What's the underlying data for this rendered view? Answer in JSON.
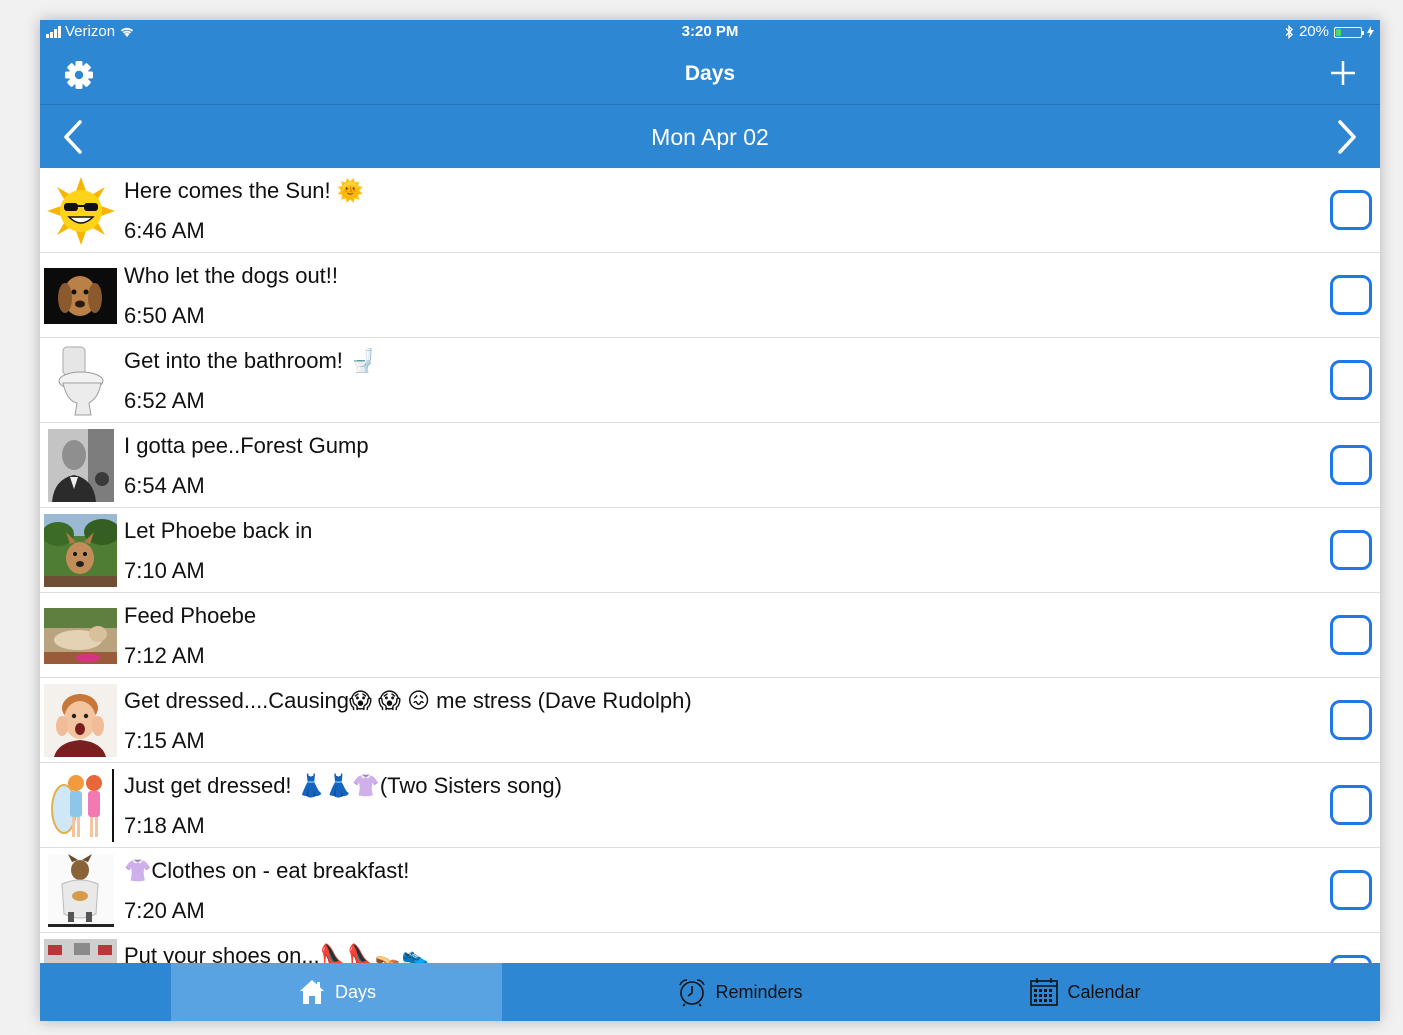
{
  "status_bar": {
    "carrier": "Verizon",
    "time": "3:20 PM",
    "battery": "20%",
    "battery_level": 0.2
  },
  "nav": {
    "title": "Days"
  },
  "date_bar": {
    "date": "Mon Apr 02"
  },
  "tasks": [
    {
      "title": "Here comes the Sun! 🌞",
      "time": "6:46 AM",
      "thumb": "sun-icon"
    },
    {
      "title": "Who let the dogs out!!",
      "time": "6:50 AM",
      "thumb": "dog-photo"
    },
    {
      "title": "Get into the bathroom! 🚽",
      "time": "6:52 AM",
      "thumb": "toilet-icon"
    },
    {
      "title": "I gotta pee..Forest Gump",
      "time": "6:54 AM",
      "thumb": "man-photo"
    },
    {
      "title": "Let Phoebe back in",
      "time": "7:10 AM",
      "thumb": "dog-photo"
    },
    {
      "title": "Feed Phoebe",
      "time": "7:12 AM",
      "thumb": "dog-photo"
    },
    {
      "title": "Get dressed....Causing😱 😱 😖 me stress (Dave Rudolph)",
      "time": "7:15 AM",
      "thumb": "boy-photo"
    },
    {
      "title": "Just get dressed! 👗👗👚(Two Sisters song)",
      "time": "7:18 AM",
      "thumb": "sisters-drawing"
    },
    {
      "title": "👚Clothes on - eat breakfast!",
      "time": "7:20 AM",
      "thumb": "dog-shirt-photo"
    },
    {
      "title": "Put your shoes on...👠👠👡👟",
      "time": "",
      "thumb": "shoes-photo"
    }
  ],
  "tabs": [
    {
      "label": "Days",
      "icon": "house-icon",
      "active": true
    },
    {
      "label": "Reminders",
      "icon": "alarm-clock-icon",
      "active": false
    },
    {
      "label": "Calendar",
      "icon": "calendar-icon",
      "active": false
    }
  ],
  "colors": {
    "primary": "#2e87d3",
    "active_tab": "#5aa3e2",
    "checkbox": "#1f77e8"
  }
}
